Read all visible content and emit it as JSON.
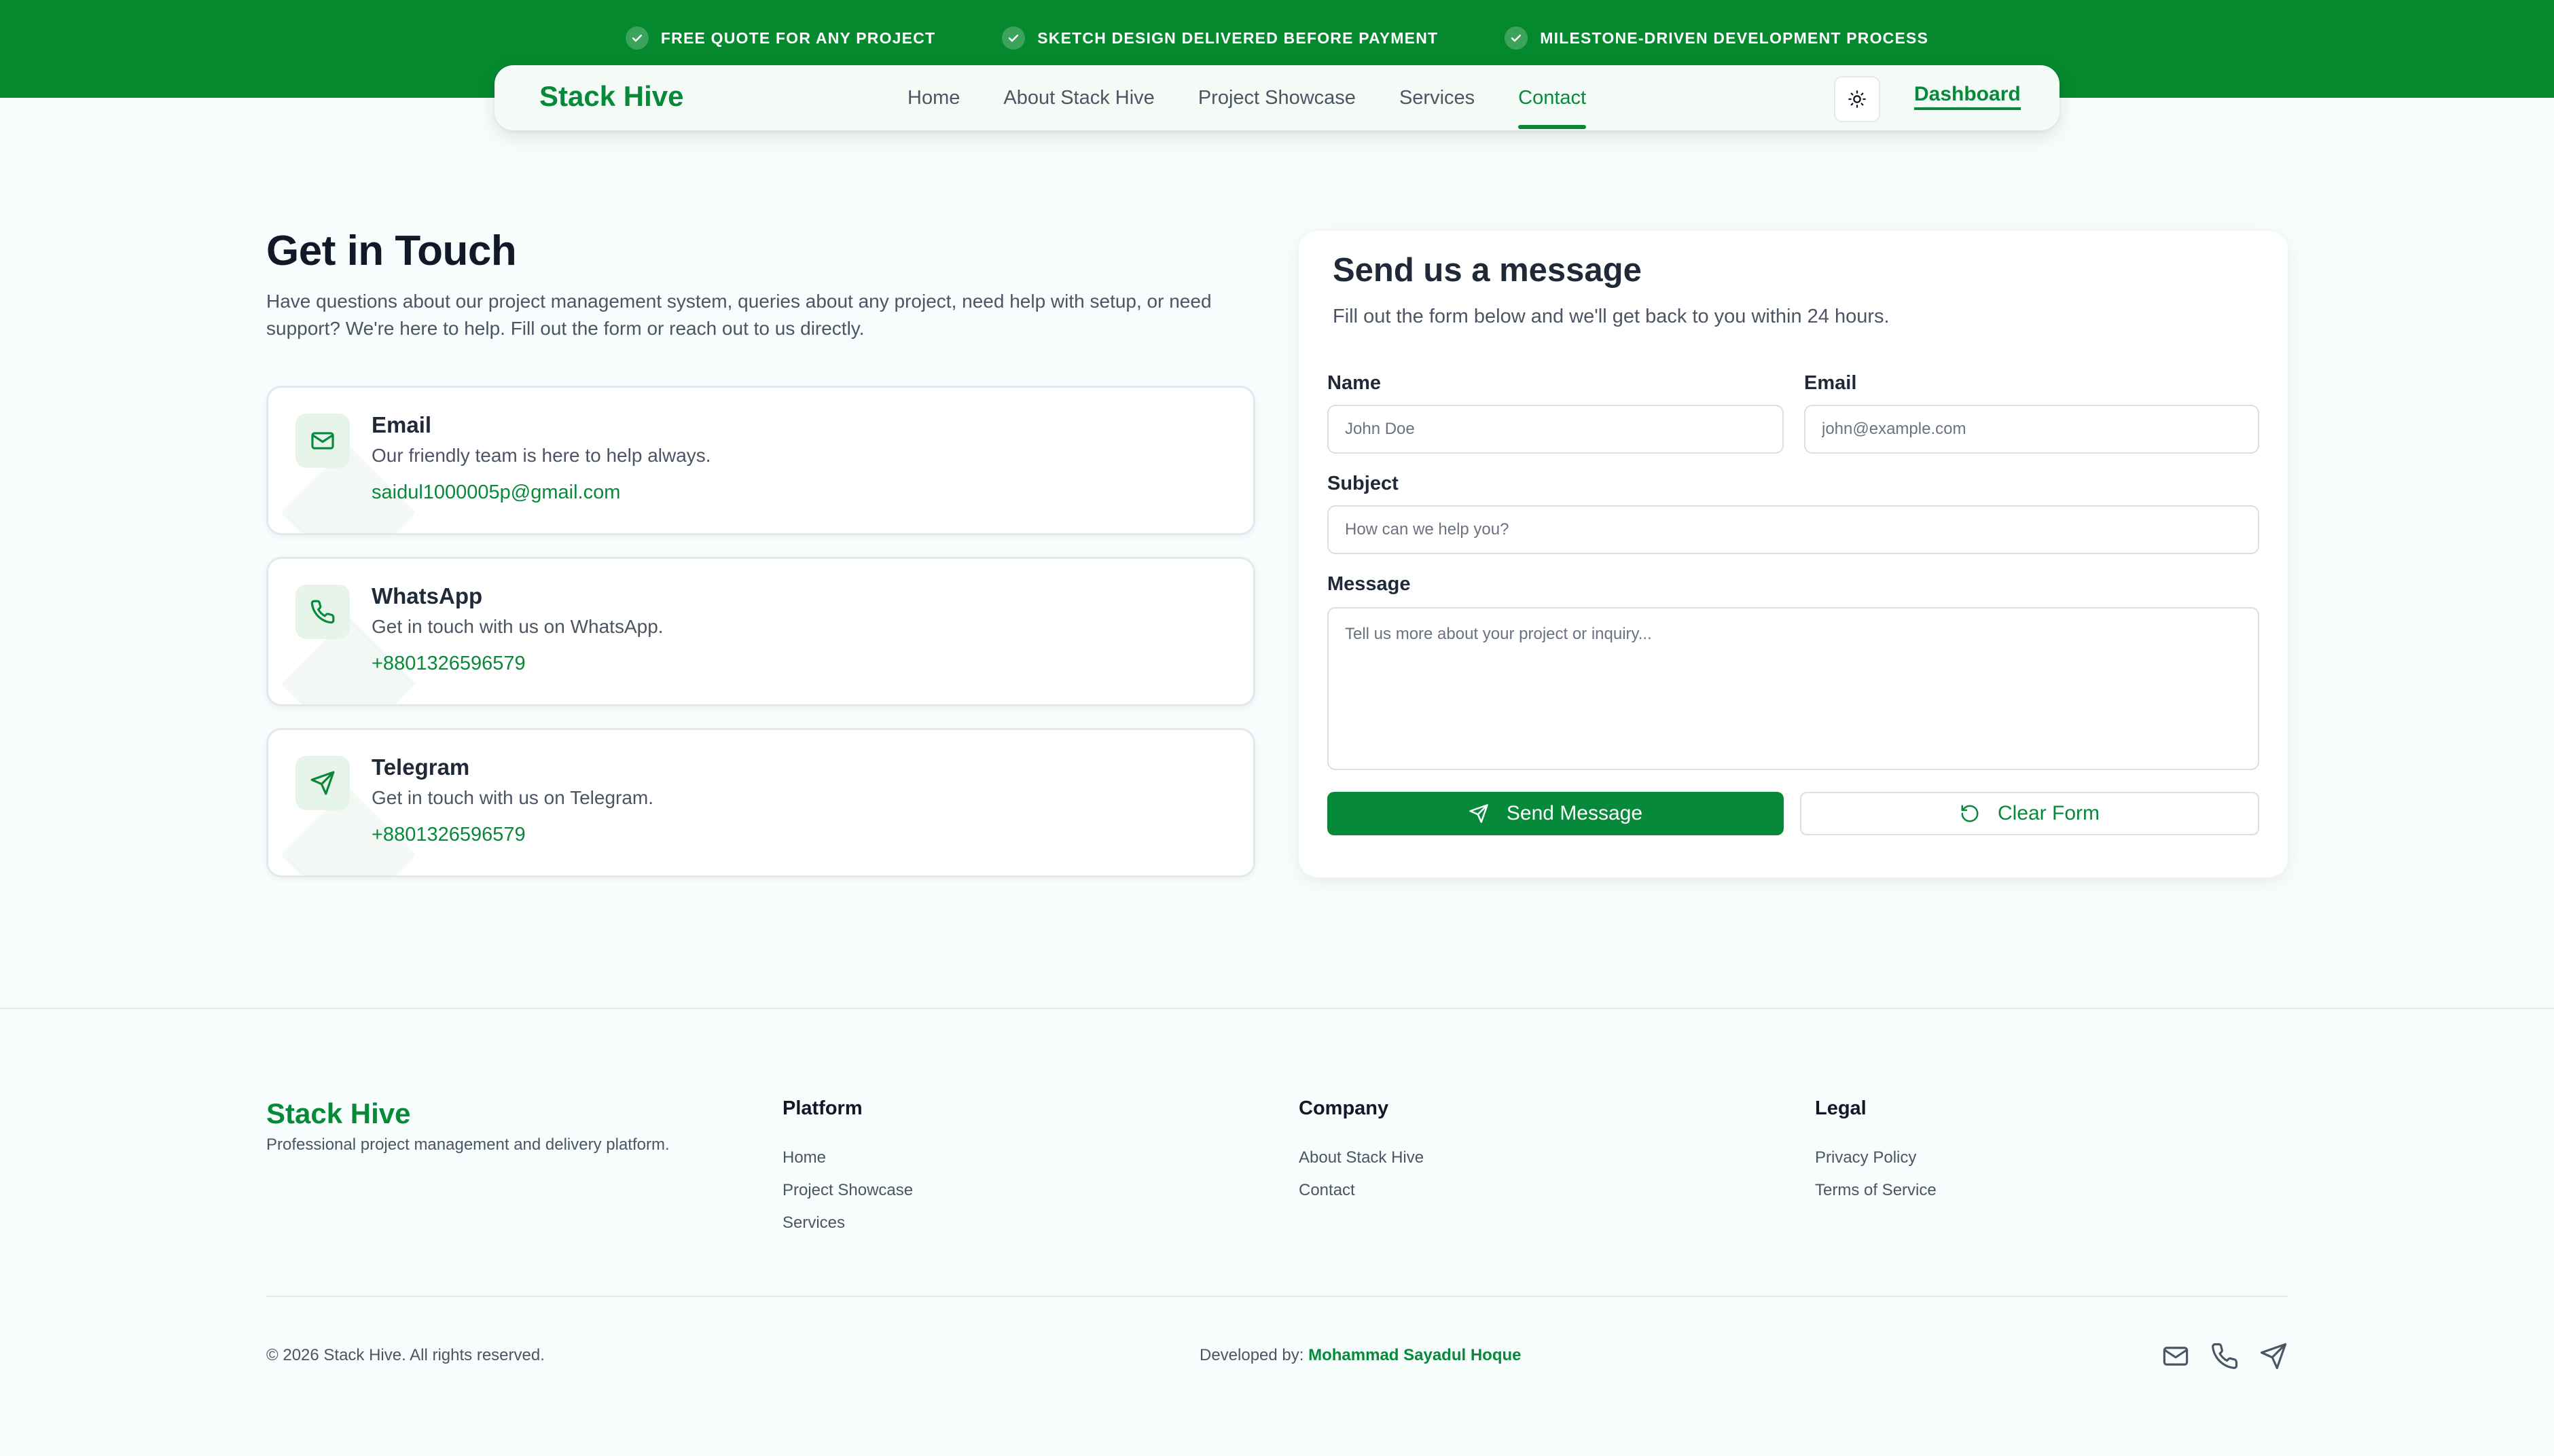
{
  "colors": {
    "brand_green": "#07893a",
    "banner_green": "#05892f",
    "page_background": "#f7fcfd",
    "text_dark": "#111827",
    "text_muted": "#4b5563"
  },
  "banner": {
    "items": [
      {
        "label": "FREE QUOTE FOR ANY PROJECT",
        "icon": "check-icon"
      },
      {
        "label": "SKETCH DESIGN DELIVERED BEFORE PAYMENT",
        "icon": "check-icon"
      },
      {
        "label": "MILESTONE-DRIVEN DEVELOPMENT PROCESS",
        "icon": "check-icon"
      }
    ]
  },
  "nav": {
    "brand": "Stack Hive",
    "links": [
      {
        "label": "Home"
      },
      {
        "label": "About Stack Hive"
      },
      {
        "label": "Project Showcase"
      },
      {
        "label": "Services"
      },
      {
        "label": "Contact",
        "active": true
      }
    ],
    "theme_icon": "sun-icon",
    "dashboard": "Dashboard"
  },
  "contact": {
    "title": "Get in Touch",
    "intro": "Have questions about our project management system, queries about any project, need help with setup, or need support? We're here to help. Fill out the form or reach out to us directly.",
    "cards": [
      {
        "title": "Email",
        "desc": "Our friendly team is here to help always.",
        "link": "saidul1000005p@gmail.com",
        "icon": "mail-icon"
      },
      {
        "title": "WhatsApp",
        "desc": "Get in touch with us on WhatsApp.",
        "link": "+8801326596579",
        "icon": "phone-icon"
      },
      {
        "title": "Telegram",
        "desc": "Get in touch with us on Telegram.",
        "link": "+8801326596579",
        "icon": "send-icon"
      }
    ]
  },
  "form": {
    "title": "Send us a message",
    "subtitle": "Fill out the form below and we'll get back to you within 24 hours.",
    "name_label": "Name",
    "name_placeholder": "John Doe",
    "name_value": "",
    "email_label": "Email",
    "email_placeholder": "john@example.com",
    "email_value": "",
    "subject_label": "Subject",
    "subject_placeholder": "How can we help you?",
    "subject_value": "",
    "message_label": "Message",
    "message_placeholder": "Tell us more about your project or inquiry...",
    "message_value": "",
    "send_label": "Send Message",
    "clear_label": "Clear Form"
  },
  "footer": {
    "brand": "Stack Hive",
    "tagline": "Professional project management and delivery platform.",
    "columns": [
      {
        "title": "Platform",
        "links": [
          "Home",
          "Project Showcase",
          "Services"
        ]
      },
      {
        "title": "Company",
        "links": [
          "About Stack Hive",
          "Contact"
        ]
      },
      {
        "title": "Legal",
        "links": [
          "Privacy Policy",
          "Terms of Service"
        ]
      }
    ],
    "copyright": "© 2026 Stack Hive. All rights reserved.",
    "developed_by_label": "Developed by: ",
    "developer": "Mohammad Sayadul Hoque",
    "social_icons": [
      "mail-icon",
      "phone-icon",
      "send-icon"
    ]
  }
}
